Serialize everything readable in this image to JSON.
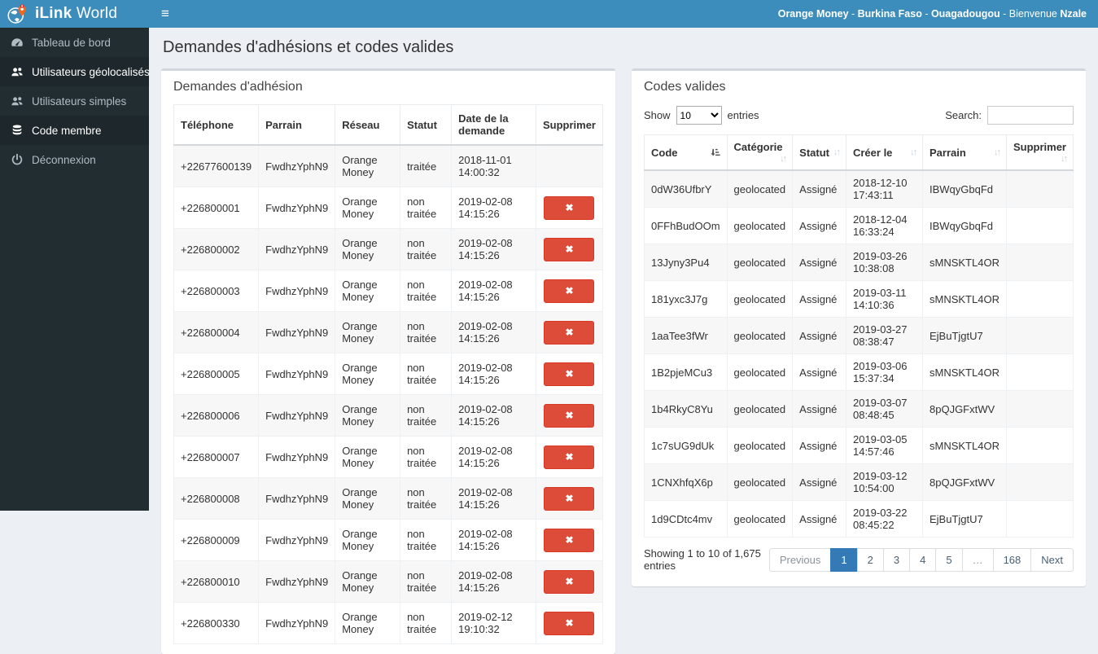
{
  "brand": {
    "bold": "iLink",
    "regular": " World"
  },
  "navbar": {
    "hamburger": "≡",
    "user_segments": [
      {
        "text": "Orange Money",
        "bold": true
      },
      {
        "text": " - ",
        "bold": false
      },
      {
        "text": "Burkina Faso",
        "bold": true
      },
      {
        "text": " - ",
        "bold": false
      },
      {
        "text": "Ouagadougou",
        "bold": true
      },
      {
        "text": " - ",
        "bold": false
      },
      {
        "text": "Bienvenue ",
        "bold": false
      },
      {
        "text": "Nzale",
        "bold": true
      }
    ]
  },
  "sidebar": {
    "items": [
      {
        "label": "Tableau de bord",
        "icon": "dashboard-icon",
        "active": false
      },
      {
        "label": "Utilisateurs géolocalisés",
        "icon": "users-icon",
        "active": true
      },
      {
        "label": "Utilisateurs simples",
        "icon": "users-icon",
        "active": false
      },
      {
        "label": "Code membre",
        "icon": "database-icon",
        "active": true
      },
      {
        "label": "Déconnexion",
        "icon": "power-icon",
        "active": false
      }
    ]
  },
  "page": {
    "title": "Demandes d'adhésions et codes valides"
  },
  "adhesions": {
    "panel_title": "Demandes d'adhésion",
    "columns": [
      "Téléphone",
      "Parrain",
      "Réseau",
      "Statut",
      "Date de la demande",
      "Supprimer"
    ],
    "delete_icon": "✖",
    "rows": [
      {
        "cells": [
          "+22677600139",
          "FwdhzYphN9",
          "Orange Money",
          "traitée",
          "2018-11-01 14:00:32"
        ],
        "can_delete": false
      },
      {
        "cells": [
          "+226800001",
          "FwdhzYphN9",
          "Orange Money",
          "non traitée",
          "2019-02-08 14:15:26"
        ],
        "can_delete": true
      },
      {
        "cells": [
          "+226800002",
          "FwdhzYphN9",
          "Orange Money",
          "non traitée",
          "2019-02-08 14:15:26"
        ],
        "can_delete": true
      },
      {
        "cells": [
          "+226800003",
          "FwdhzYphN9",
          "Orange Money",
          "non traitée",
          "2019-02-08 14:15:26"
        ],
        "can_delete": true
      },
      {
        "cells": [
          "+226800004",
          "FwdhzYphN9",
          "Orange Money",
          "non traitée",
          "2019-02-08 14:15:26"
        ],
        "can_delete": true
      },
      {
        "cells": [
          "+226800005",
          "FwdhzYphN9",
          "Orange Money",
          "non traitée",
          "2019-02-08 14:15:26"
        ],
        "can_delete": true
      },
      {
        "cells": [
          "+226800006",
          "FwdhzYphN9",
          "Orange Money",
          "non traitée",
          "2019-02-08 14:15:26"
        ],
        "can_delete": true
      },
      {
        "cells": [
          "+226800007",
          "FwdhzYphN9",
          "Orange Money",
          "non traitée",
          "2019-02-08 14:15:26"
        ],
        "can_delete": true
      },
      {
        "cells": [
          "+226800008",
          "FwdhzYphN9",
          "Orange Money",
          "non traitée",
          "2019-02-08 14:15:26"
        ],
        "can_delete": true
      },
      {
        "cells": [
          "+226800009",
          "FwdhzYphN9",
          "Orange Money",
          "non traitée",
          "2019-02-08 14:15:26"
        ],
        "can_delete": true
      },
      {
        "cells": [
          "+226800010",
          "FwdhzYphN9",
          "Orange Money",
          "non traitée",
          "2019-02-08 14:15:26"
        ],
        "can_delete": true
      },
      {
        "cells": [
          "+226800330",
          "FwdhzYphN9",
          "Orange Money",
          "non traitée",
          "2019-02-12 19:10:32"
        ],
        "can_delete": true
      }
    ]
  },
  "codes": {
    "panel_title": "Codes valides",
    "show_label": "Show",
    "page_length": "10",
    "entries_label": "entries",
    "search_label": "Search:",
    "search_value": "",
    "columns": [
      {
        "label": "Code",
        "sort": "asc"
      },
      {
        "label": "Catégorie",
        "sort": "none"
      },
      {
        "label": "Statut",
        "sort": "none"
      },
      {
        "label": "Créer le",
        "sort": "none"
      },
      {
        "label": "Parrain",
        "sort": "none"
      },
      {
        "label": "Supprimer",
        "sort": "none"
      }
    ],
    "rows": [
      [
        "0dW36UfbrY",
        "geolocated",
        "Assigné",
        "2018-12-10 17:43:11",
        "IBWqyGbqFd",
        ""
      ],
      [
        "0FFhBudOOm",
        "geolocated",
        "Assigné",
        "2018-12-04 16:33:24",
        "IBWqyGbqFd",
        ""
      ],
      [
        "13Jyny3Pu4",
        "geolocated",
        "Assigné",
        "2019-03-26 10:38:08",
        "sMNSKTL4OR",
        ""
      ],
      [
        "181yxc3J7g",
        "geolocated",
        "Assigné",
        "2019-03-11 14:10:36",
        "sMNSKTL4OR",
        ""
      ],
      [
        "1aaTee3fWr",
        "geolocated",
        "Assigné",
        "2019-03-27 08:38:47",
        "EjBuTjgtU7",
        ""
      ],
      [
        "1B2pjeMCu3",
        "geolocated",
        "Assigné",
        "2019-03-06 15:37:34",
        "sMNSKTL4OR",
        ""
      ],
      [
        "1b4RkyC8Yu",
        "geolocated",
        "Assigné",
        "2019-03-07 08:48:45",
        "8pQJGFxtWV",
        ""
      ],
      [
        "1c7sUG9dUk",
        "geolocated",
        "Assigné",
        "2019-03-05 14:57:46",
        "sMNSKTL4OR",
        ""
      ],
      [
        "1CNXhfqX6p",
        "geolocated",
        "Assigné",
        "2019-03-12 10:54:00",
        "8pQJGFxtWV",
        ""
      ],
      [
        "1d9CDtc4mv",
        "geolocated",
        "Assigné",
        "2019-03-22 08:45:22",
        "EjBuTjgtU7",
        ""
      ]
    ],
    "info": "Showing 1 to 10 of 1,675 entries",
    "pagination": [
      {
        "label": "Previous",
        "state": "disabled"
      },
      {
        "label": "1",
        "state": "active"
      },
      {
        "label": "2",
        "state": ""
      },
      {
        "label": "3",
        "state": ""
      },
      {
        "label": "4",
        "state": ""
      },
      {
        "label": "5",
        "state": ""
      },
      {
        "label": "…",
        "state": "ellipsis"
      },
      {
        "label": "168",
        "state": ""
      },
      {
        "label": "Next",
        "state": ""
      }
    ]
  },
  "colors": {
    "navbar_blue": "#3c8dbc",
    "sidebar_dark": "#222d32",
    "sidebar_active": "#1e282c",
    "danger_red": "#dd4b39",
    "pagination_active": "#337ab7",
    "pin_orange": "#f4661b"
  }
}
